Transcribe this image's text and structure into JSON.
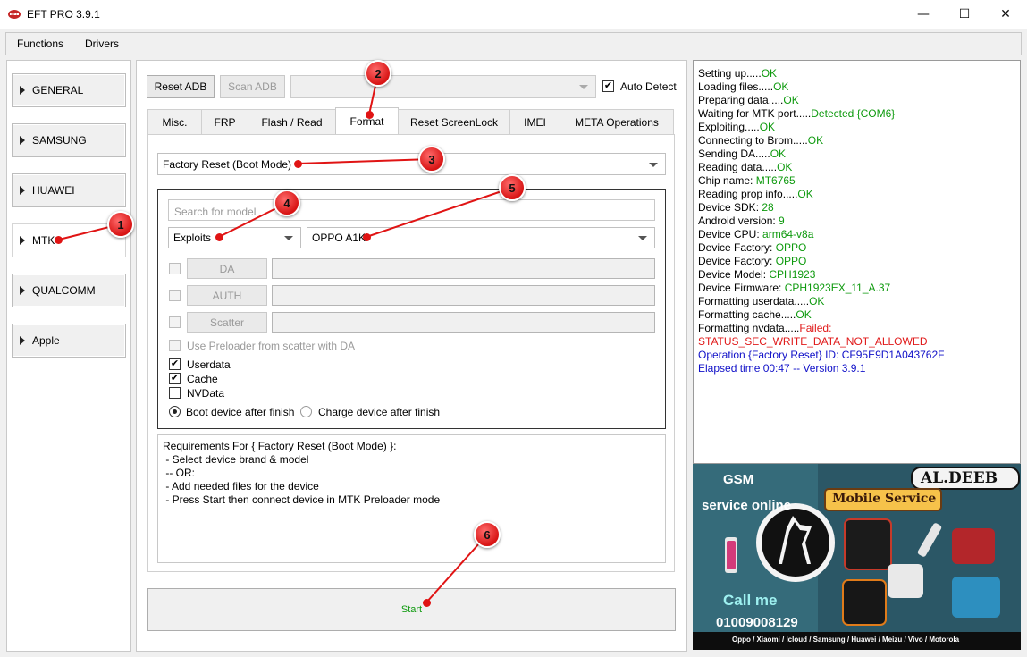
{
  "window": {
    "title": "EFT PRO 3.9.1",
    "controls": {
      "minimize": "—",
      "maximize": "☐",
      "close": "✕"
    }
  },
  "menubar": {
    "items": [
      "Functions",
      "Drivers"
    ]
  },
  "sidebar": {
    "items": [
      {
        "label": "GENERAL"
      },
      {
        "label": "SAMSUNG"
      },
      {
        "label": "HUAWEI"
      },
      {
        "label": "MTK"
      },
      {
        "label": "QUALCOMM"
      },
      {
        "label": "Apple"
      }
    ],
    "active": "MTK"
  },
  "toolbar": {
    "reset_adb": "Reset ADB",
    "scan_adb": "Scan ADB",
    "port_value": "",
    "auto_detect": "Auto Detect",
    "auto_detect_checked": true
  },
  "tabs": [
    {
      "label": "Misc."
    },
    {
      "label": "FRP"
    },
    {
      "label": "Flash / Read"
    },
    {
      "label": "Format"
    },
    {
      "label": "Reset ScreenLock"
    },
    {
      "label": "IMEI"
    },
    {
      "label": "META Operations"
    }
  ],
  "active_tab": "Format",
  "format": {
    "operation": "Factory Reset (Boot Mode)",
    "search_placeholder": "Search for model",
    "brand": "Exploits",
    "model": "OPPO A1K",
    "files": [
      {
        "button": "DA",
        "value": ""
      },
      {
        "button": "AUTH",
        "value": ""
      },
      {
        "button": "Scatter",
        "value": ""
      }
    ],
    "use_preloader": "Use Preloader from scatter with DA",
    "options": [
      {
        "label": "Userdata",
        "checked": true
      },
      {
        "label": "Cache",
        "checked": true
      },
      {
        "label": "NVData",
        "checked": false
      }
    ],
    "after_finish": [
      {
        "label": "Boot device after finish",
        "selected": true
      },
      {
        "label": "Charge device after finish",
        "selected": false
      }
    ],
    "requirements": [
      "Requirements For { Factory Reset (Boot Mode) }:",
      " - Select device brand & model",
      " -- OR:",
      " - Add needed files for the device",
      " - Press Start then connect device in MTK Preloader mode"
    ],
    "start": "Start"
  },
  "log": [
    {
      "text": "Setting up.....",
      "status": "OK",
      "kind": "ok"
    },
    {
      "text": "Loading files.....",
      "status": "OK",
      "kind": "ok"
    },
    {
      "text": "Preparing data.....",
      "status": "OK",
      "kind": "ok"
    },
    {
      "text": "Waiting for MTK port.....",
      "status": "Detected {COM6}",
      "kind": "ok"
    },
    {
      "text": "Exploiting.....",
      "status": "OK",
      "kind": "ok"
    },
    {
      "text": "Connecting to Brom.....",
      "status": "OK",
      "kind": "ok"
    },
    {
      "text": "Sending DA.....",
      "status": "OK",
      "kind": "ok"
    },
    {
      "text": "Reading data.....",
      "status": "OK",
      "kind": "ok"
    },
    {
      "text": "Chip name: ",
      "status": "MT6765",
      "kind": "ok"
    },
    {
      "text": "Reading prop info.....",
      "status": "OK",
      "kind": "ok"
    },
    {
      "text": "Device SDK: ",
      "status": "28",
      "kind": "ok"
    },
    {
      "text": "Android version: ",
      "status": "9",
      "kind": "ok"
    },
    {
      "text": "Device CPU: ",
      "status": "arm64-v8a",
      "kind": "ok"
    },
    {
      "text": "Device Factory: ",
      "status": "OPPO",
      "kind": "ok"
    },
    {
      "text": "Device Factory: ",
      "status": "OPPO",
      "kind": "ok"
    },
    {
      "text": "Device Model: ",
      "status": "CPH1923",
      "kind": "ok"
    },
    {
      "text": "Device Firmware: ",
      "status": "CPH1923EX_11_A.37",
      "kind": "ok"
    },
    {
      "text": "Formatting userdata.....",
      "status": "OK",
      "kind": "ok"
    },
    {
      "text": "Formatting cache.....",
      "status": "OK",
      "kind": "ok"
    },
    {
      "text": "Formatting nvdata.....",
      "status": "Failed:",
      "kind": "fail"
    },
    {
      "text": "",
      "status": "STATUS_SEC_WRITE_DATA_NOT_ALLOWED",
      "kind": "fail"
    },
    {
      "text": "",
      "status": "Operation {Factory Reset} ID: CF95E9D1A043762F",
      "kind": "info"
    },
    {
      "text": "",
      "status": "Elapsed time 00:47 -- Version 3.9.1",
      "kind": "info"
    }
  ],
  "ad": {
    "gsm": "GSM",
    "brand": "AL.DEEB",
    "service_online": "service online",
    "mobile_service": "Mobile Service",
    "call_me": "Call me",
    "phone": "01009008129",
    "brands": "Oppo / Xiaomi / Icloud / Samsung / Huawei / Meizu / Vivo / Motorola"
  },
  "annotations": [
    "1",
    "2",
    "3",
    "4",
    "5",
    "6"
  ],
  "colors": {
    "ok": "#0e9a0e",
    "fail": "#e01a1a",
    "info": "#1010c8",
    "marker": "#e01414",
    "start_text": "#0e9a0e"
  }
}
